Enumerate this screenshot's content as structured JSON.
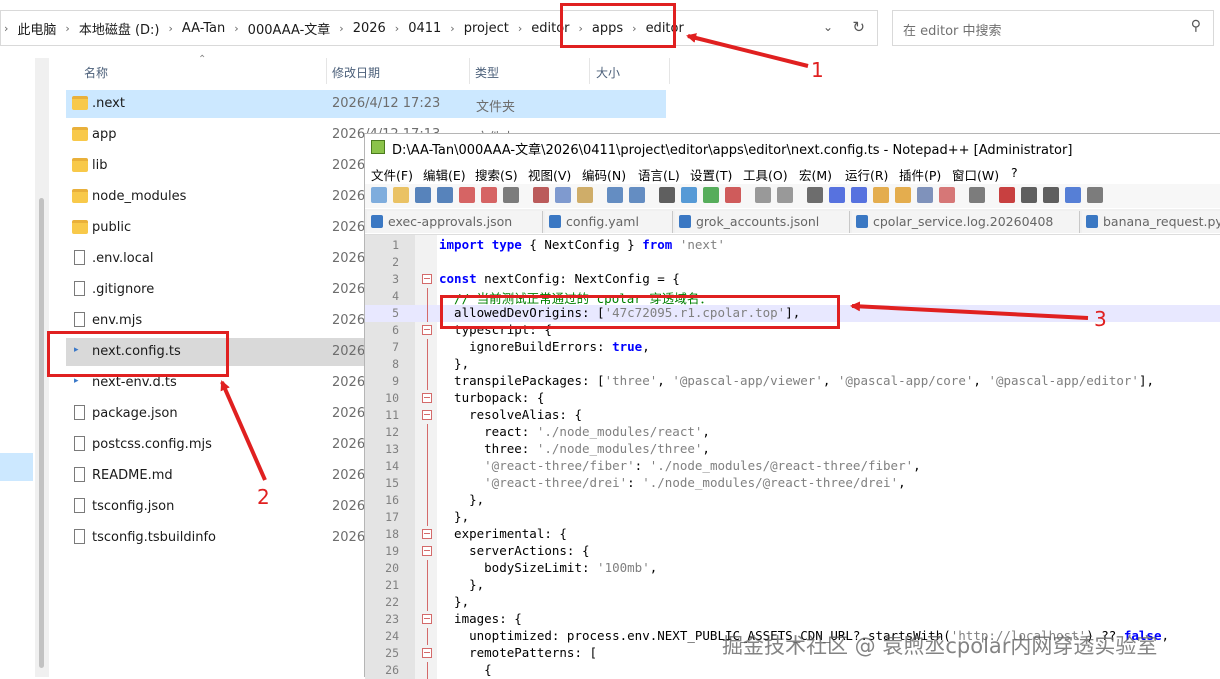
{
  "explorer": {
    "breadcrumb": [
      "此电脑",
      "本地磁盘 (D:)",
      "AA-Tan",
      "000AAA-文章",
      "2026",
      "0411",
      "project",
      "editor",
      "apps",
      "editor"
    ],
    "search_placeholder": "在 editor 中搜索",
    "columns": {
      "name": "名称",
      "date": "修改日期",
      "type": "类型",
      "size": "大小"
    },
    "files": [
      {
        "name": ".next",
        "date": "2026/4/12 17:23",
        "type": "文件夹",
        "kind": "folder"
      },
      {
        "name": "app",
        "date": "2026/4/12 17:13",
        "type": "文件夹",
        "kind": "folder"
      },
      {
        "name": "lib",
        "date": "2026/",
        "type": "",
        "kind": "folder"
      },
      {
        "name": "node_modules",
        "date": "2026/",
        "type": "",
        "kind": "folder"
      },
      {
        "name": "public",
        "date": "2026/",
        "type": "",
        "kind": "folder"
      },
      {
        "name": ".env.local",
        "date": "2026/",
        "type": "",
        "kind": "file"
      },
      {
        "name": ".gitignore",
        "date": "2026/",
        "type": "",
        "kind": "file"
      },
      {
        "name": "env.mjs",
        "date": "2026/",
        "type": "",
        "kind": "file"
      },
      {
        "name": "next.config.ts",
        "date": "2026/",
        "type": "",
        "kind": "ts"
      },
      {
        "name": "next-env.d.ts",
        "date": "2026/",
        "type": "",
        "kind": "ts"
      },
      {
        "name": "package.json",
        "date": "2026/",
        "type": "",
        "kind": "file"
      },
      {
        "name": "postcss.config.mjs",
        "date": "2026/",
        "type": "",
        "kind": "file"
      },
      {
        "name": "README.md",
        "date": "2026/",
        "type": "",
        "kind": "md"
      },
      {
        "name": "tsconfig.json",
        "date": "2026/",
        "type": "",
        "kind": "file"
      },
      {
        "name": "tsconfig.tsbuildinfo",
        "date": "2026/",
        "type": "",
        "kind": "file"
      }
    ]
  },
  "notepad": {
    "title": "D:\\AA-Tan\\000AAA-文章\\2026\\0411\\project\\editor\\apps\\editor\\next.config.ts - Notepad++ [Administrator]",
    "menu": [
      "文件(F)",
      "编辑(E)",
      "搜索(S)",
      "视图(V)",
      "编码(N)",
      "语言(L)",
      "设置(T)",
      "工具(O)",
      "宏(M)",
      "运行(R)",
      "插件(P)",
      "窗口(W)",
      "?"
    ],
    "tabs": [
      "exec-approvals.json",
      "config.yaml",
      "grok_accounts.jsonl",
      "cpolar_service.log.20260408",
      "banana_request.py"
    ],
    "lines": [
      {
        "n": "1",
        "text": "import type { NextConfig } from 'next'"
      },
      {
        "n": "2",
        "text": ""
      },
      {
        "n": "3",
        "text": "const nextConfig: NextConfig = {"
      },
      {
        "n": "4",
        "text": "  // 当前测试正常通过的 cpolar 穿透域名："
      },
      {
        "n": "5",
        "text": "  allowedDevOrigins: ['47c72095.r1.cpolar.top'],"
      },
      {
        "n": "6",
        "text": "  typescript: {"
      },
      {
        "n": "7",
        "text": "    ignoreBuildErrors: true,"
      },
      {
        "n": "8",
        "text": "  },"
      },
      {
        "n": "9",
        "text": "  transpilePackages: ['three', '@pascal-app/viewer', '@pascal-app/core', '@pascal-app/editor'],"
      },
      {
        "n": "10",
        "text": "  turbopack: {"
      },
      {
        "n": "11",
        "text": "    resolveAlias: {"
      },
      {
        "n": "12",
        "text": "      react: './node_modules/react',"
      },
      {
        "n": "13",
        "text": "      three: './node_modules/three',"
      },
      {
        "n": "14",
        "text": "      '@react-three/fiber': './node_modules/@react-three/fiber',"
      },
      {
        "n": "15",
        "text": "      '@react-three/drei': './node_modules/@react-three/drei',"
      },
      {
        "n": "16",
        "text": "    },"
      },
      {
        "n": "17",
        "text": "  },"
      },
      {
        "n": "18",
        "text": "  experimental: {"
      },
      {
        "n": "19",
        "text": "    serverActions: {"
      },
      {
        "n": "20",
        "text": "      bodySizeLimit: '100mb',"
      },
      {
        "n": "21",
        "text": "    },"
      },
      {
        "n": "22",
        "text": "  },"
      },
      {
        "n": "23",
        "text": "  images: {"
      },
      {
        "n": "24",
        "text": "    unoptimized: process.env.NEXT_PUBLIC_ASSETS_CDN_URL?.startsWith('http://localhost') ?? false,"
      },
      {
        "n": "25",
        "text": "    remotePatterns: ["
      },
      {
        "n": "26",
        "text": "      {"
      }
    ]
  },
  "annotations": [
    "1",
    "2",
    "3"
  ],
  "watermark": "掘金技术社区 @ 袁煦丞cpolar内网穿透实验室",
  "colors": {
    "accent_red": "#e02020",
    "selection": "#cce8ff"
  }
}
